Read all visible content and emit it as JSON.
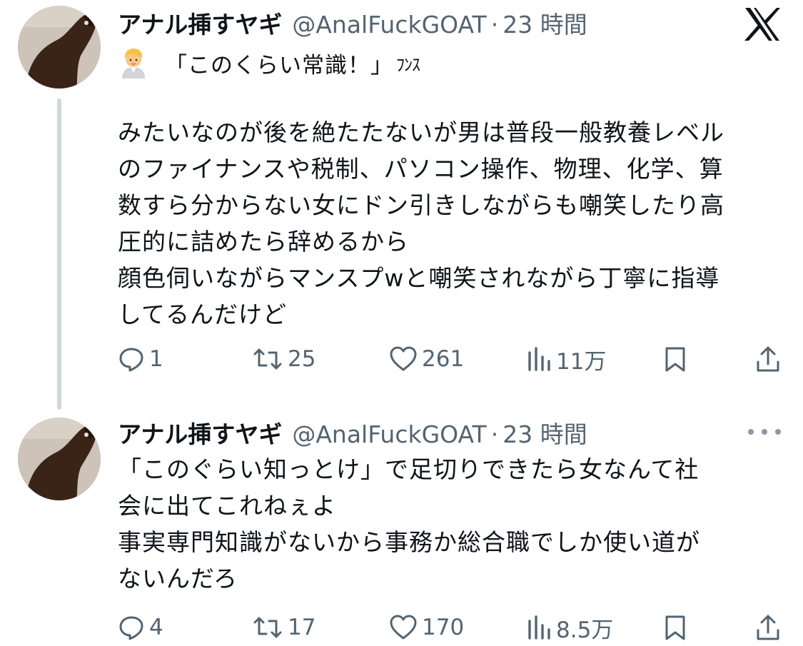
{
  "brand_icon": "x-logo-icon",
  "tweets": [
    {
      "display_name": "アナル挿すヤギ",
      "handle": "@AnalFuckGOAT",
      "separator": "·",
      "time": "23 時間",
      "first_line": {
        "emoji": "man-blond-emoji",
        "quote": "「このくらい常識！」",
        "trailing": "ﾌﾝｽ"
      },
      "body_lines": [
        "みたいなのが後を絶たたないが男は普段一般教養レベル",
        "のファイナンスや税制、パソコン操作、物理、化学、算",
        "数すら分からない女にドン引きしながらも嘲笑したり高",
        "圧的に詰めたら辞めるから",
        "顔色伺いながらマンスプwと嘲笑されながら丁寧に指導",
        "してるんだけど"
      ],
      "replies": "1",
      "reposts": "25",
      "likes": "261",
      "views": "11万"
    },
    {
      "display_name": "アナル挿すヤギ",
      "handle": "@AnalFuckGOAT",
      "separator": "·",
      "time": "23 時間",
      "body_lines": [
        "「このぐらい知っとけ」で足切りできたら女なんて社",
        "会に出てこれねぇよ",
        "事実専門知識がないから事務か総合職でしか使い道が",
        "ないんだろ"
      ],
      "replies": "4",
      "reposts": "17",
      "likes": "170",
      "views": "8.5万"
    }
  ]
}
